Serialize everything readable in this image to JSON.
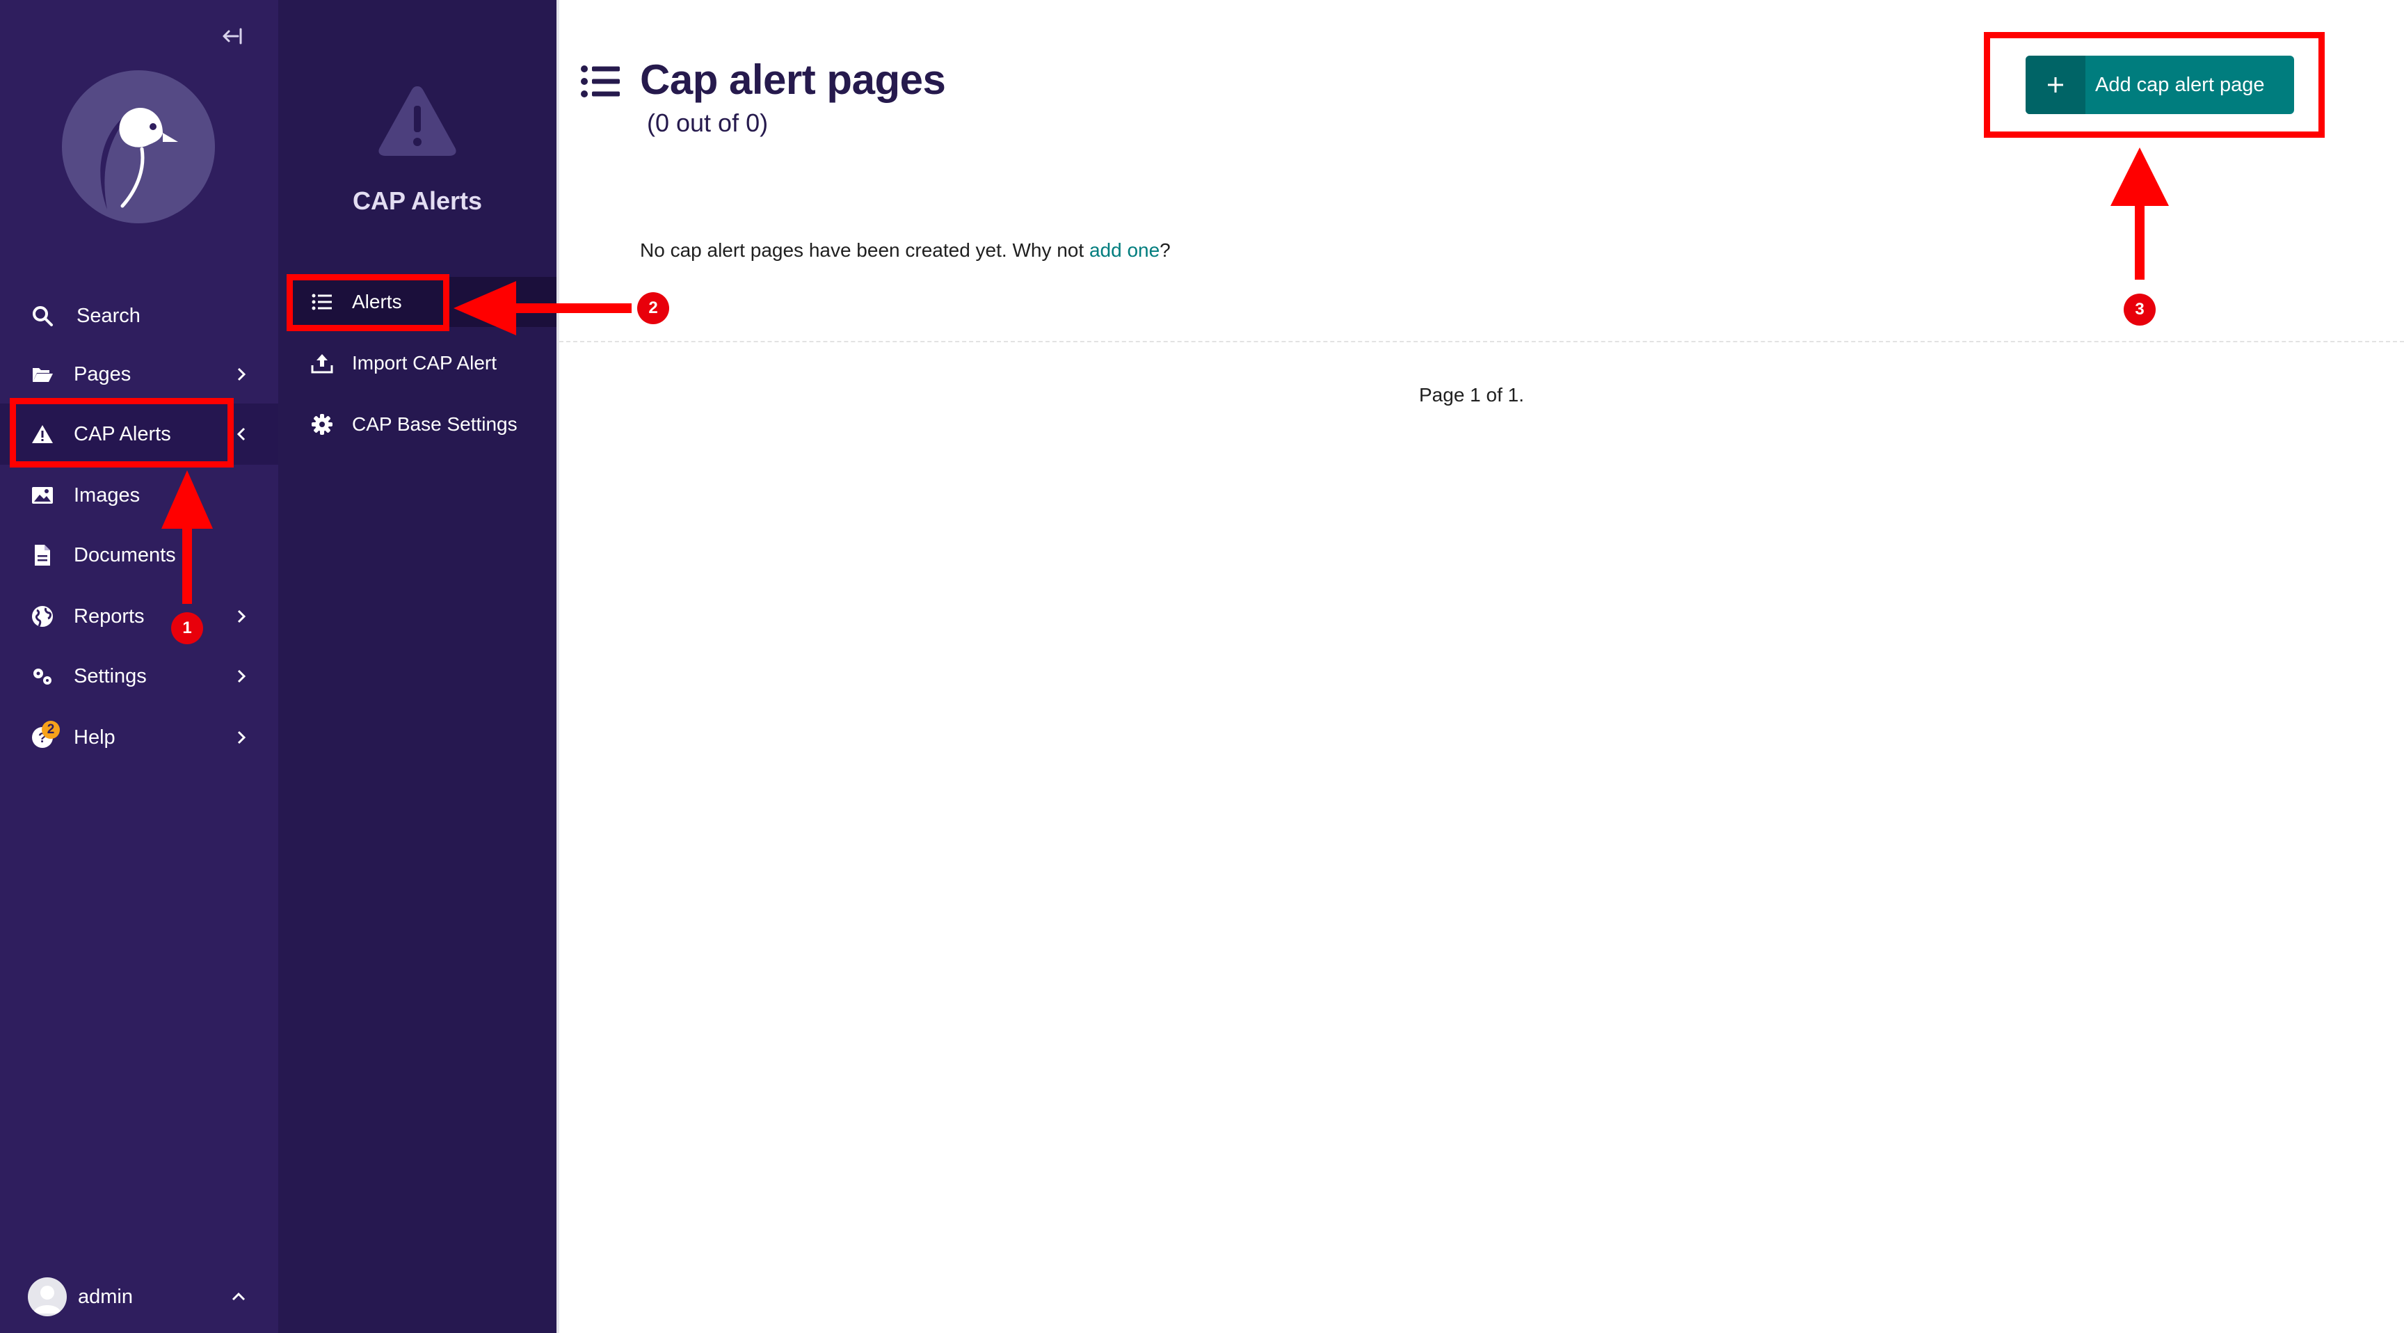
{
  "sidebar": {
    "collapse_icon": "collapse-sidebar-icon",
    "logo": "wagtail-bird-logo",
    "items": [
      {
        "label": "Search",
        "icon": "search-icon"
      },
      {
        "label": "Pages",
        "icon": "folder-open-icon"
      },
      {
        "label": "CAP Alerts",
        "icon": "warning-icon",
        "active": true
      },
      {
        "label": "Images",
        "icon": "image-icon"
      },
      {
        "label": "Documents",
        "icon": "document-icon"
      },
      {
        "label": "Reports",
        "icon": "globe-icon"
      },
      {
        "label": "Settings",
        "icon": "cogs-icon"
      },
      {
        "label": "Help",
        "icon": "help-icon",
        "badge": "2"
      }
    ],
    "account": {
      "username": "admin"
    }
  },
  "submenu": {
    "title": "CAP Alerts",
    "items": [
      {
        "label": "Alerts",
        "icon": "list-icon",
        "active": true
      },
      {
        "label": "Import CAP Alert",
        "icon": "upload-icon"
      },
      {
        "label": "CAP Base Settings",
        "icon": "gear-icon"
      }
    ]
  },
  "main": {
    "title": "Cap alert pages",
    "count_text": "(0 out of 0)",
    "add_button_label": "Add cap alert page",
    "empty_message": {
      "prefix": "No cap alert pages have been created yet. Why not ",
      "link": "add one",
      "suffix": "?"
    },
    "pagination": "Page 1 of 1."
  },
  "annotations": {
    "steps": [
      "1",
      "2",
      "3"
    ],
    "color": "#ff0000"
  },
  "colors": {
    "sidebar_bg": "#2f1e5e",
    "submenu_bg": "#261850",
    "accent": "#007d7e",
    "title": "#261a4d"
  }
}
